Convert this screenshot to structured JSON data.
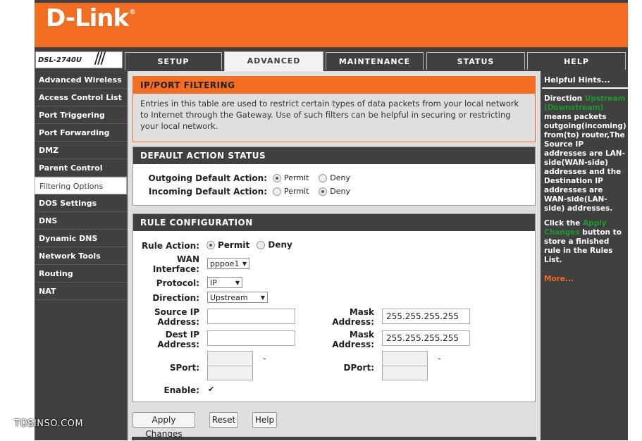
{
  "brand": {
    "logo": "D-Link",
    "trademark": "®"
  },
  "model": {
    "name": "DSL-2740U",
    "slashes": "///"
  },
  "tabs": [
    {
      "label": "SETUP"
    },
    {
      "label": "ADVANCED",
      "active": true
    },
    {
      "label": "MAINTENANCE"
    },
    {
      "label": "STATUS"
    },
    {
      "label": "HELP"
    }
  ],
  "sidebar": {
    "items": [
      {
        "label": "Advanced Wireless"
      },
      {
        "label": "Access Control List"
      },
      {
        "label": "Port Triggering"
      },
      {
        "label": "Port Forwarding"
      },
      {
        "label": "DMZ"
      },
      {
        "label": "Parent Control"
      },
      {
        "label": "Filtering Options",
        "active": true
      },
      {
        "label": "DOS Settings"
      },
      {
        "label": "DNS"
      },
      {
        "label": "Dynamic DNS"
      },
      {
        "label": "Network Tools"
      },
      {
        "label": "Routing"
      },
      {
        "label": "NAT"
      }
    ]
  },
  "intro": {
    "title": "IP/PORT FILTERING",
    "text": "Entries in this table are used to restrict certain types of data packets from your local network to Internet through the Gateway. Use of such filters can be helpful in securing or restricting your local network."
  },
  "default_action": {
    "title": "DEFAULT ACTION STATUS",
    "outgoing_label": "Outgoing Default Action:",
    "incoming_label": "Incoming Default Action:",
    "permit_label": "Permit",
    "deny_label": "Deny",
    "outgoing_value": "Permit",
    "incoming_value": "Deny"
  },
  "rule": {
    "title": "RULE CONFIGURATION",
    "rule_action_label": "Rule Action:",
    "permit_label": "Permit",
    "deny_label": "Deny",
    "rule_action_value": "Permit",
    "wan_label_1": "WAN",
    "wan_label_2": "Interface:",
    "wan_value": "pppoe1",
    "protocol_label": "Protocol:",
    "protocol_value": "IP",
    "direction_label": "Direction:",
    "direction_value": "Upstream",
    "src_label_1": "Source IP",
    "src_label_2": "Address:",
    "src_value": "",
    "src_mask_label_1": "Mask",
    "src_mask_label_2": "Address:",
    "src_mask_value": "255.255.255.255",
    "dst_label_1": "Dest IP",
    "dst_label_2": "Address:",
    "dst_value": "",
    "dst_mask_label_1": "Mask",
    "dst_mask_label_2": "Address:",
    "dst_mask_value": "255.255.255.255",
    "sport_label": "SPort:",
    "dport_label": "DPort:",
    "dash": "-",
    "enable_label": "Enable:",
    "enable_checked": true
  },
  "buttons": {
    "apply": "Apply Changes",
    "reset": "Reset",
    "help": "Help"
  },
  "hints": {
    "title": "Helpful Hints...",
    "p1_a": "Direction",
    "p1_green": "Upstream (Downstream)",
    "p1_b": "means packets outgoing(incoming) from(to) router,The Source IP addresses are LAN-side(WAN-side) addresses and the Destination IP addresses are WAN-side(LAN-side) addresses.",
    "p2_a": "Click the",
    "p2_green": "Apply Changes",
    "p2_b": "button to store a finished rule in the Rules List.",
    "more": "More..."
  },
  "watermark": "TOSINSO.COM",
  "colors": {
    "orange": "#f26d21",
    "dark": "#404040",
    "green": "#1a9a2a"
  }
}
